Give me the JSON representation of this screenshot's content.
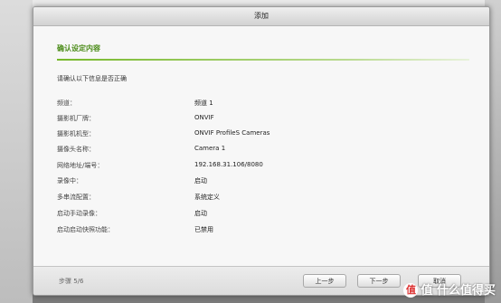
{
  "dialog": {
    "title": "添加",
    "section_title": "确认设定内容",
    "intro": "请确认以下信息是否正确",
    "rows": [
      {
        "label": "频道：",
        "value": "频道 1"
      },
      {
        "label": "摄影机厂牌：",
        "value": "ONVIF"
      },
      {
        "label": "摄影机机型：",
        "value": "ONVIF ProfileS Cameras"
      },
      {
        "label": "摄像头名称：",
        "value": "Camera 1"
      },
      {
        "label": "网络地址/端号：",
        "value": "192.168.31.106/8080"
      },
      {
        "label": "录像中：",
        "value": "启动"
      },
      {
        "label": "多串流配置：",
        "value": "系统定义"
      },
      {
        "label": "启动手动录像：",
        "value": "启动"
      },
      {
        "label": "启动启动快照功能：",
        "value": "已禁用"
      }
    ],
    "footer": {
      "step": "步骤 5/6",
      "prev_label": "上一步",
      "next_label": "下一步",
      "cancel_label": "取消"
    }
  },
  "watermark": {
    "text": "值 什么值得买",
    "logo_char": "值"
  },
  "colors": {
    "accent_green": "#4a8b17",
    "section_line": "#76b82a"
  }
}
